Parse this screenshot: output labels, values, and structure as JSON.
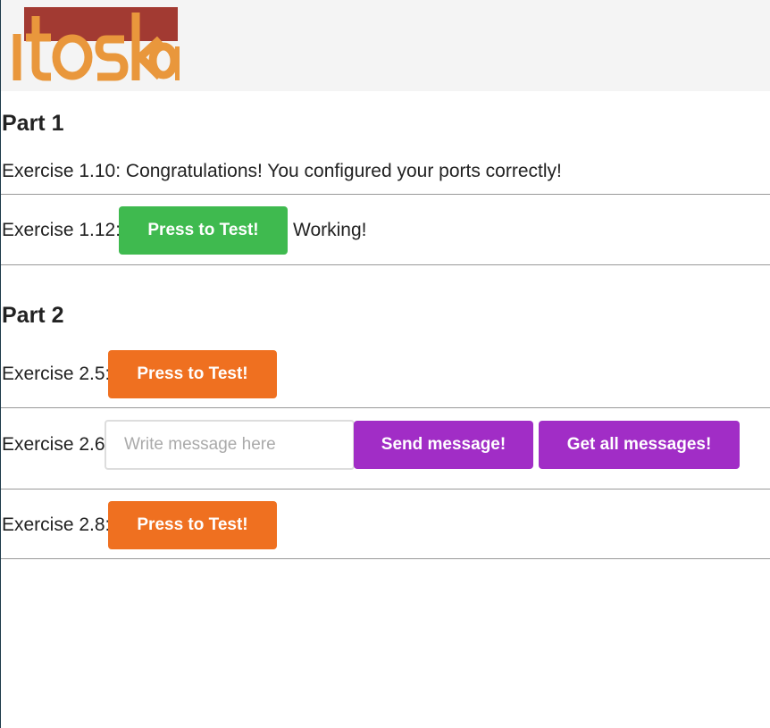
{
  "header": {
    "logo_text": "itoska"
  },
  "part1": {
    "heading": "Part 1",
    "ex110": "Exercise 1.10: Congratulations! You configured your ports correctly!",
    "ex112_label": "Exercise 1.12:",
    "ex112_button": "Press to Test!",
    "ex112_status": "Working!"
  },
  "part2": {
    "heading": "Part 2",
    "ex25_label": "Exercise 2.5:",
    "ex25_button": "Press to Test!",
    "ex26_label": "Exercise 2.6:",
    "ex26_placeholder": "Write message here",
    "ex26_send": "Send message!",
    "ex26_get": "Get all messages!",
    "ex28_label": "Exercise 2.8:",
    "ex28_button": "Press to Test!"
  },
  "colors": {
    "green_button": "#3fba4f",
    "orange_button": "#ef7020",
    "purple_button": "#a12dc6",
    "logo_red": "#a23a32",
    "logo_orange": "#e9973c"
  }
}
